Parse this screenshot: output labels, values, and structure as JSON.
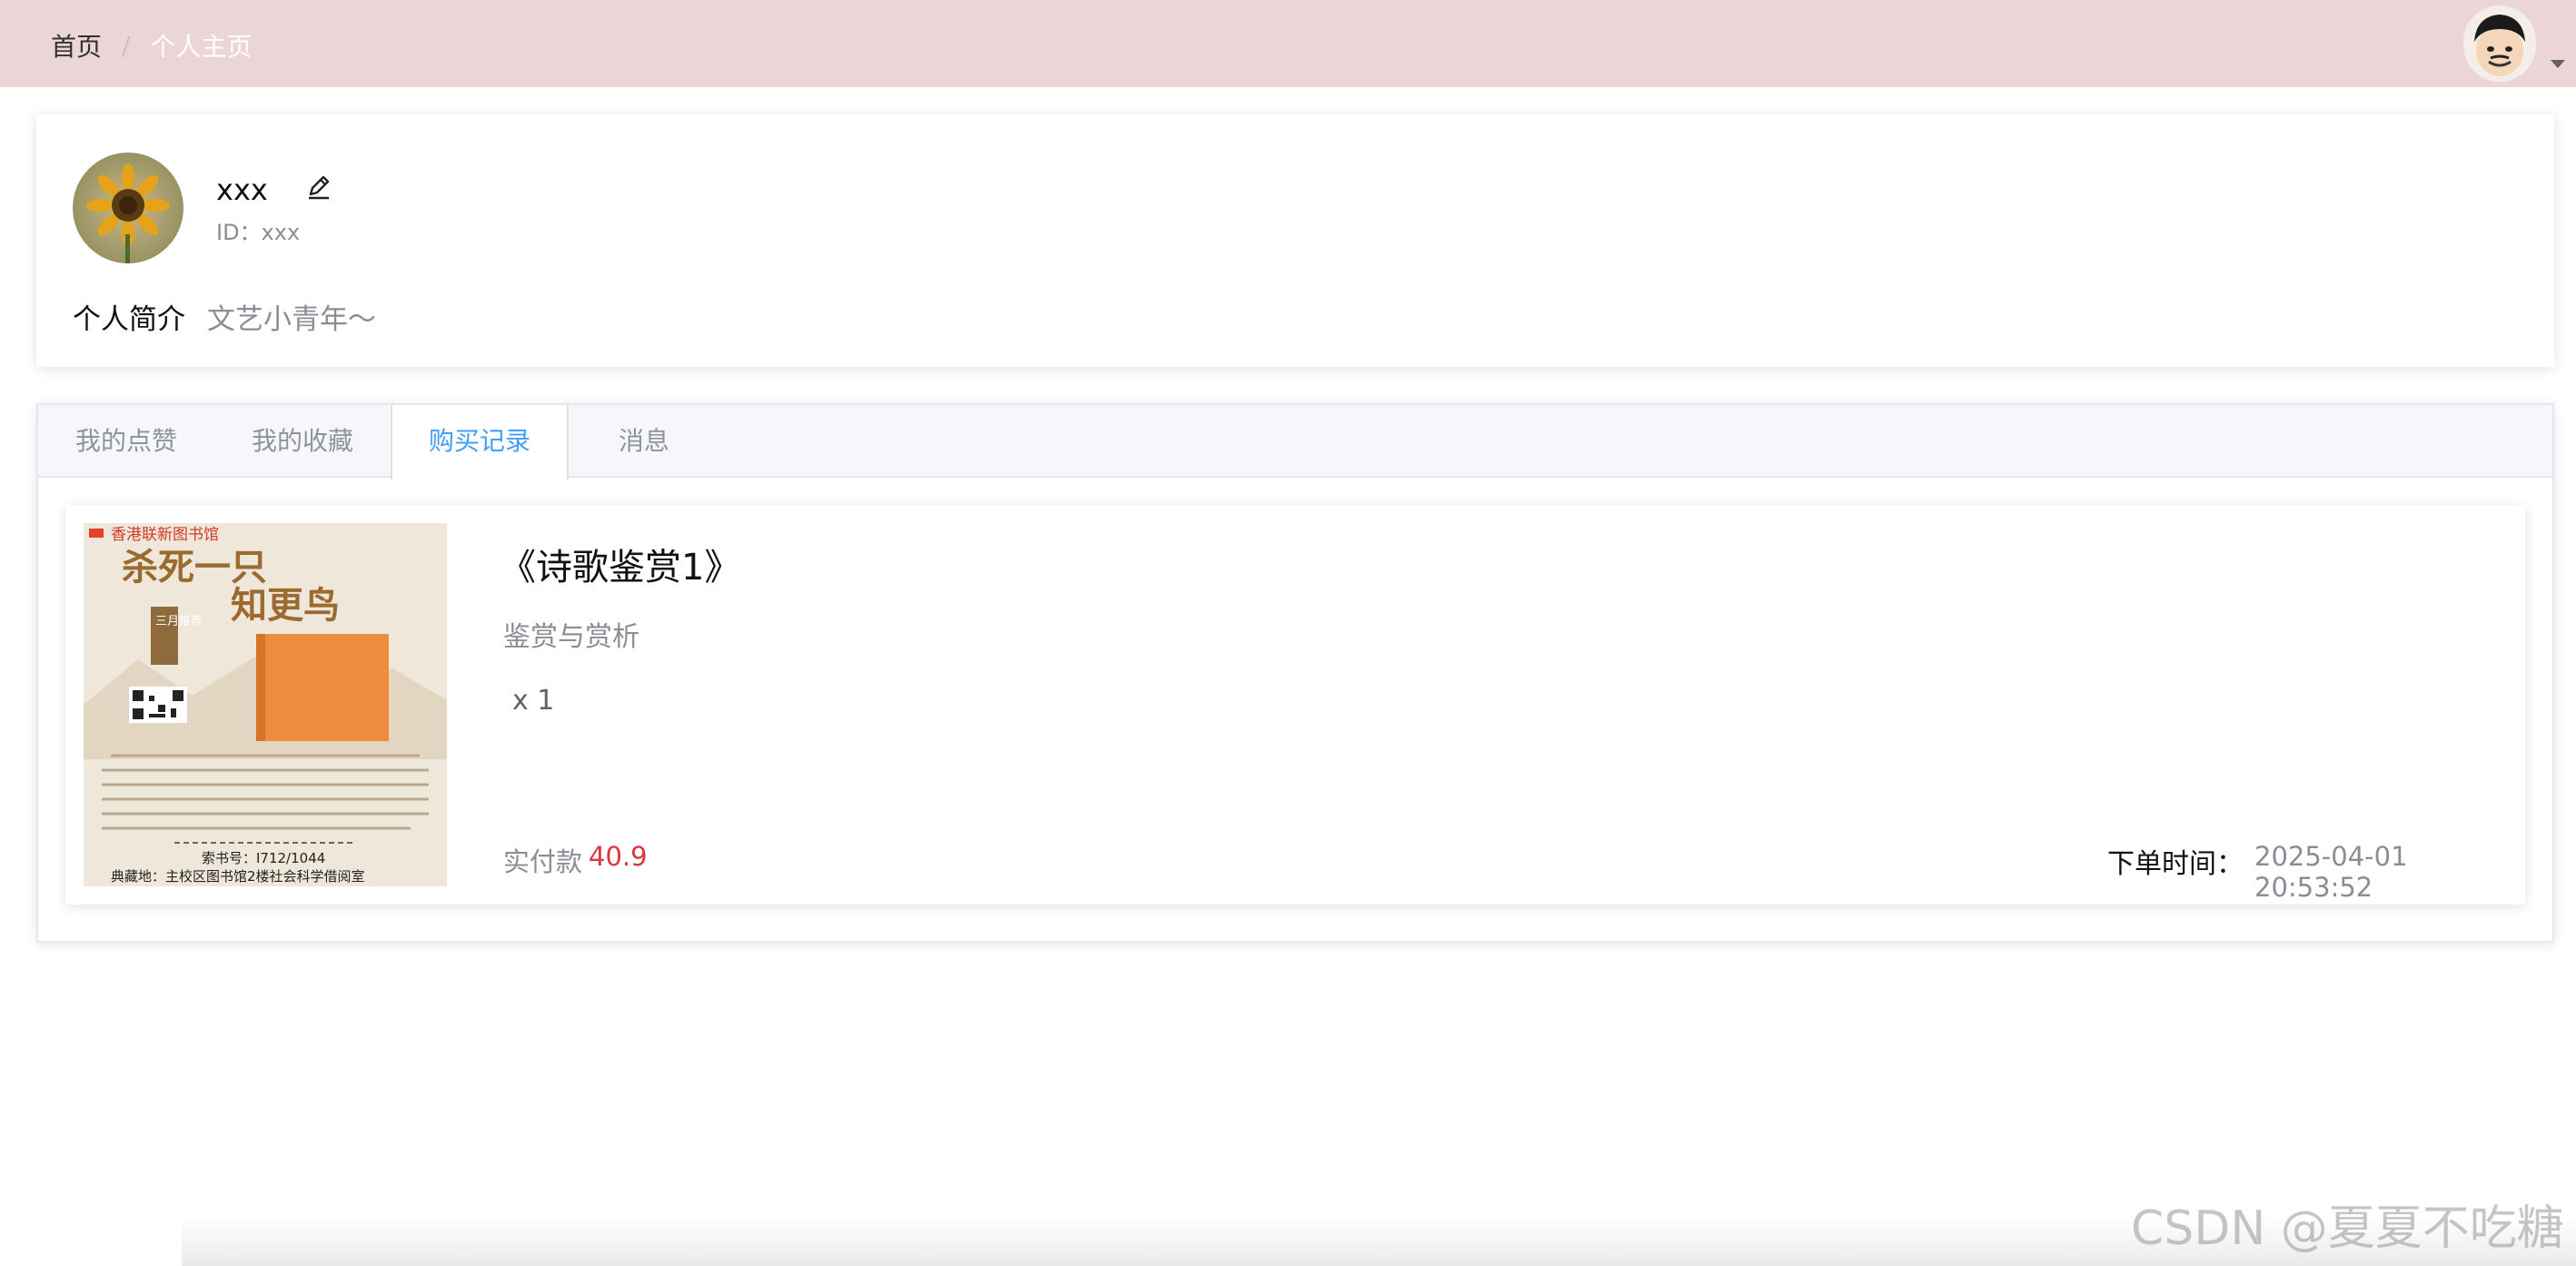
{
  "breadcrumb": {
    "home": "首页",
    "separator": "/",
    "current": "个人主页"
  },
  "header": {
    "avatar_icon": "cartoon-avatar",
    "menu_icon": "caret-down-icon"
  },
  "profile": {
    "name": "xxx",
    "id_label": "ID：xxx",
    "intro_label": "个人简介",
    "intro_text": "文艺小青年～"
  },
  "tabs": [
    {
      "label": "我的点赞"
    },
    {
      "label": "我的收藏"
    },
    {
      "label": "购买记录",
      "active": true
    },
    {
      "label": "消息"
    }
  ],
  "order": {
    "cover": {
      "banner": "香港联新图书馆",
      "title_line1": "杀死一只",
      "title_line2": "知更鸟",
      "tag": "三月推荐",
      "call_number": "索书号：I712/1044",
      "location": "典藏地：主校区图书馆2楼社会科学借阅室"
    },
    "title": "《诗歌鉴赏1》",
    "subtitle": "鉴赏与赏析",
    "quantity": "x 1",
    "paid_label": "实付款",
    "paid_value": "40.9",
    "time_label": "下单时间：",
    "time_value": "2025-04-01 20:53:52"
  },
  "watermark": "CSDN @夏夏不吃糖",
  "colors": {
    "topbar": "#ecd5d7",
    "accent": "#409eff",
    "price": "#d9363e"
  }
}
